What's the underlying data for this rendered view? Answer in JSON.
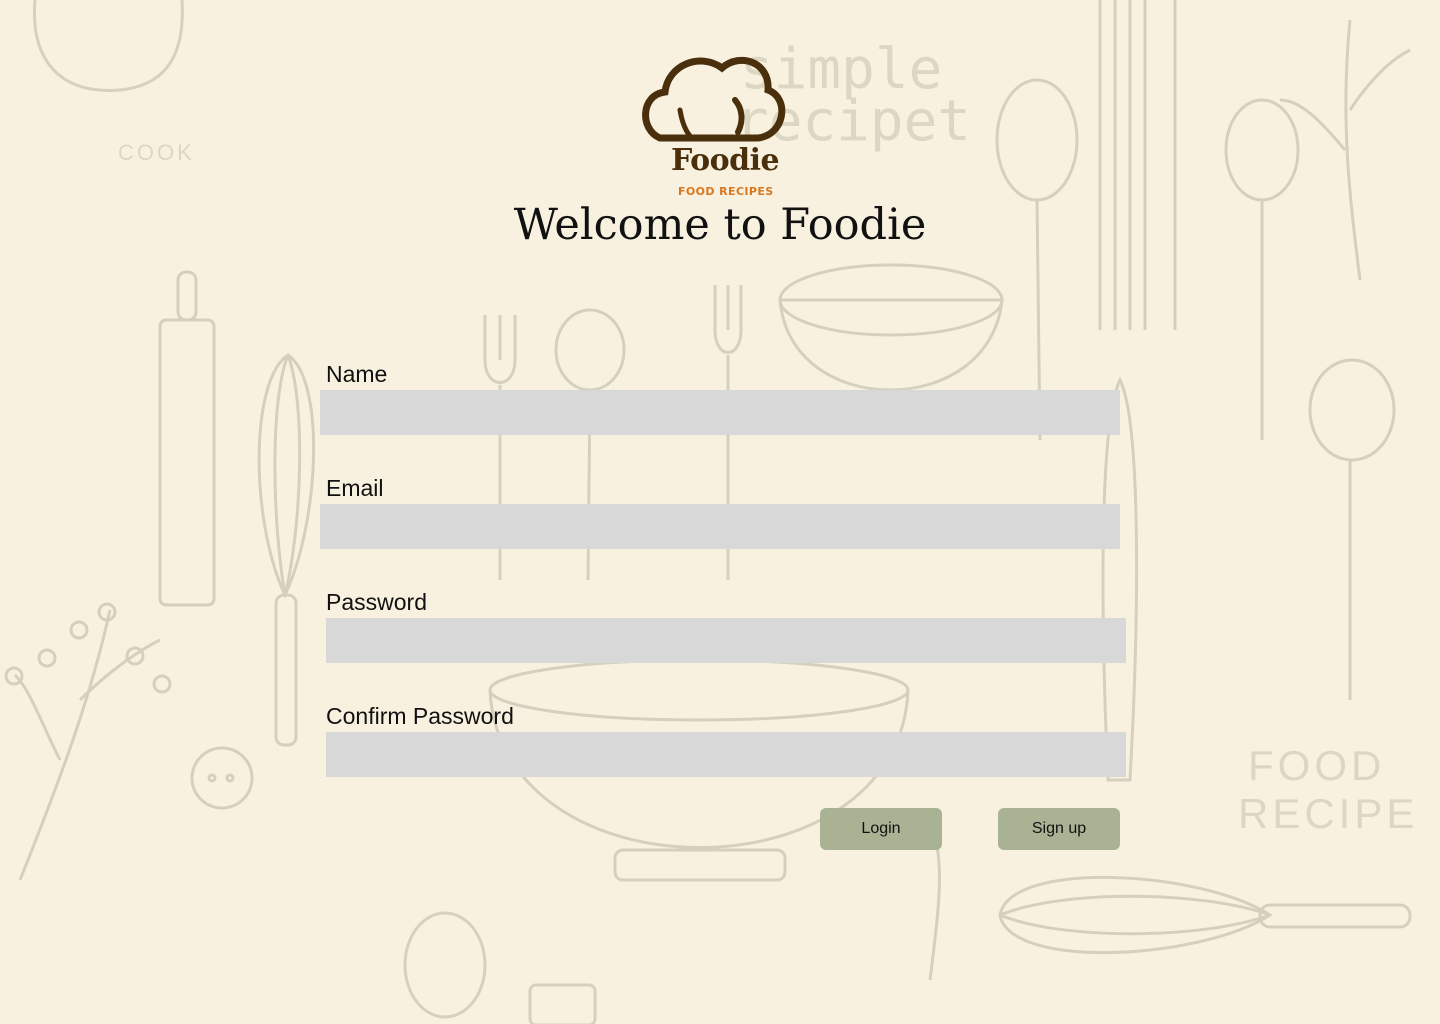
{
  "logo": {
    "name": "Foodie",
    "tagline": "FOOD RECIPES"
  },
  "page": {
    "title": "Welcome to Foodie"
  },
  "form": {
    "fields": [
      {
        "label": "Name",
        "value": "",
        "placeholder": ""
      },
      {
        "label": "Email",
        "value": "",
        "placeholder": ""
      },
      {
        "label": "Password",
        "value": "",
        "placeholder": ""
      },
      {
        "label": "Confirm Password",
        "value": "",
        "placeholder": ""
      }
    ],
    "buttons": {
      "login": "Login",
      "signup": "Sign up"
    }
  },
  "background": {
    "texts": {
      "simple": "simple",
      "recipet": "recipet",
      "cook": "COOK",
      "food": "FOOD",
      "recipe": "RECIPE"
    }
  },
  "colors": {
    "background": "#f8f1df",
    "input_fill": "#d8d8d8",
    "button_fill": "#a9b394",
    "logo_brown": "#4a2f0c",
    "logo_orange": "#d9761e"
  }
}
